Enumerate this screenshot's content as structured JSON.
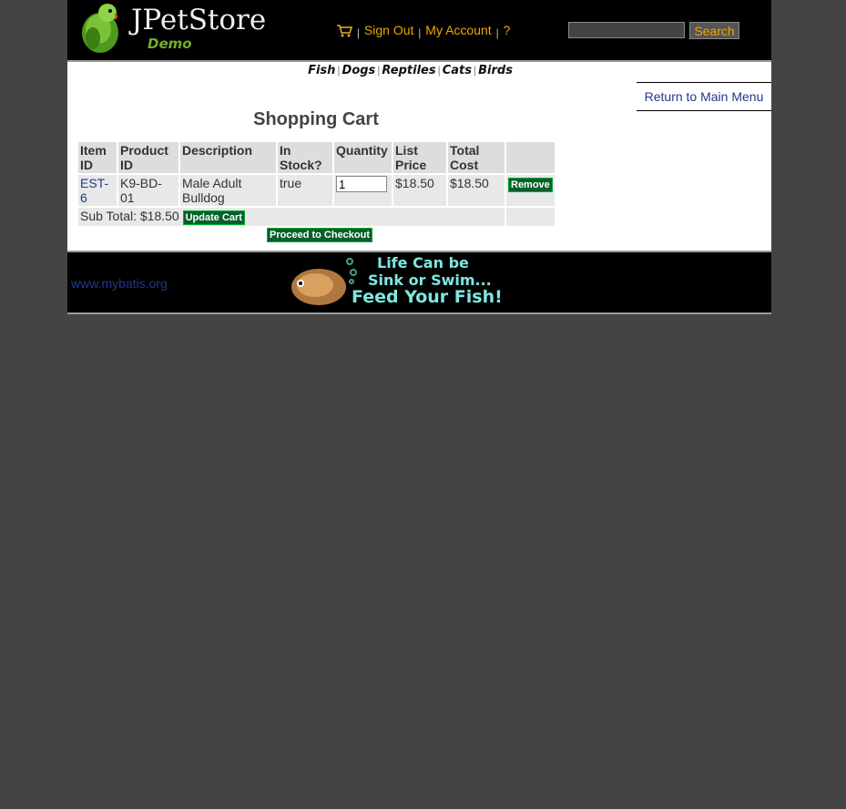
{
  "header": {
    "logo_title": "JPetStore",
    "logo_subtitle": "Demo",
    "menu": {
      "sign_out": "Sign Out",
      "my_account": "My Account",
      "help": "?",
      "separator": "|"
    },
    "search": {
      "value": "",
      "button_label": "Search"
    }
  },
  "quicklinks": [
    "Fish",
    "Dogs",
    "Reptiles",
    "Cats",
    "Birds"
  ],
  "back_link": "Return to Main Menu",
  "cart": {
    "title": "Shopping Cart",
    "columns": [
      "Item ID",
      "Product ID",
      "Description",
      "In Stock?",
      "Quantity",
      "List Price",
      "Total Cost",
      ""
    ],
    "columns_wrapped": [
      [
        "Item",
        "ID"
      ],
      [
        "Product",
        "ID"
      ],
      [
        "Description"
      ],
      [
        "In",
        "Stock?"
      ],
      [
        "Quantity"
      ],
      [
        "List",
        "Price"
      ],
      [
        "Total",
        "Cost"
      ],
      [
        ""
      ]
    ],
    "rows": [
      {
        "item_id": "EST-6",
        "item_id_lines": [
          "EST-",
          "6"
        ],
        "product_id_lines": [
          "K9-BD-",
          "01"
        ],
        "description_lines": [
          "Male Adult",
          "Bulldog"
        ],
        "in_stock": "true",
        "quantity": "1",
        "list_price": "$18.50",
        "total_cost": "$18.50",
        "remove_label": "Remove"
      }
    ],
    "subtotal_label": "Sub Total: $18.50",
    "update_label": "Update Cart",
    "checkout_label": "Proceed to Checkout"
  },
  "footer": {
    "link": "www.mybatis.org",
    "banner_lines": [
      "Life Can be",
      "Sink or Swim...",
      "Feed Your Fish!"
    ]
  },
  "colors": {
    "header_bg": "#000000",
    "menu_link": "#f0a500",
    "button_green": "#06602a",
    "link_blue": "#1e3a8a",
    "page_bg": "#444444"
  }
}
